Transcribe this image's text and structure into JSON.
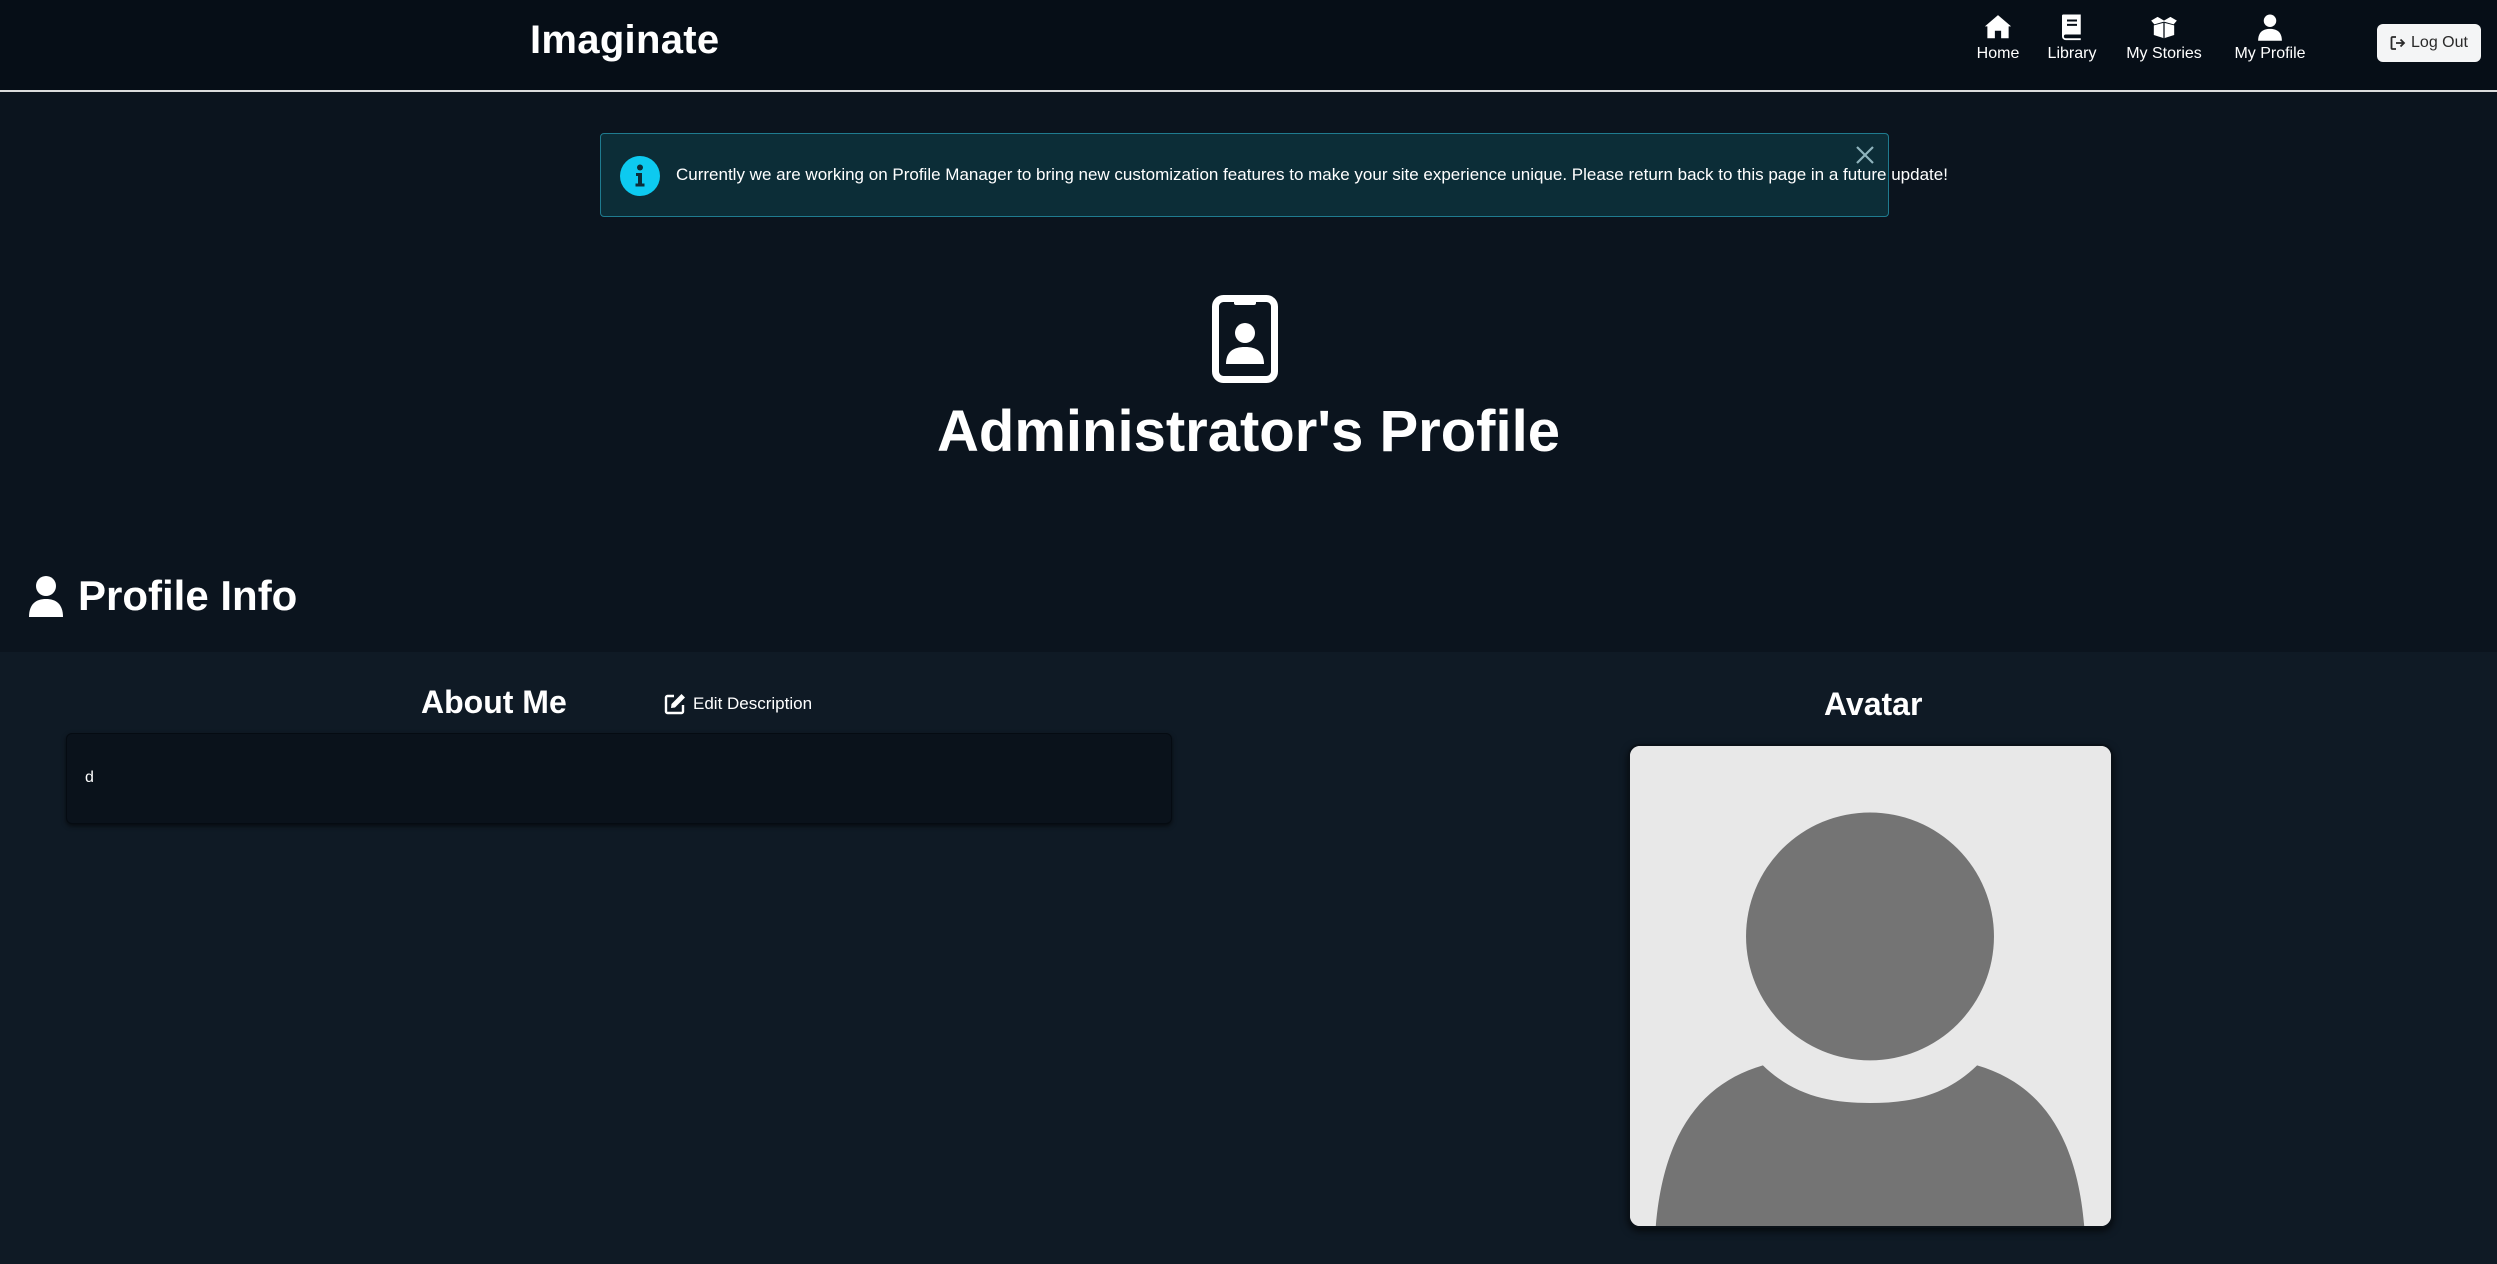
{
  "navbar": {
    "brand": "Imaginate",
    "items": [
      {
        "label": "Home",
        "icon": "home-icon"
      },
      {
        "label": "Library",
        "icon": "book-icon"
      },
      {
        "label": "My Stories",
        "icon": "box-open-icon"
      },
      {
        "label": "My Profile",
        "icon": "user-icon"
      }
    ],
    "logout_label": "Log Out",
    "logout_icon": "sign-out-icon"
  },
  "alert": {
    "icon": "info-circle-icon",
    "message": "Currently we are working on Profile Manager to bring new customization features to make your site experience unique. Please return back to this page in a future update!",
    "close_icon": "close-icon",
    "accent_color": "#0dcaf0"
  },
  "profile": {
    "badge_icon": "id-badge-icon",
    "title": "Administrator's Profile"
  },
  "profile_info": {
    "heading": "Profile Info",
    "heading_icon": "user-icon",
    "about": {
      "title": "About Me",
      "edit_label": "Edit Description",
      "edit_icon": "edit-icon",
      "text": "d"
    },
    "avatar": {
      "title": "Avatar",
      "image": "default-avatar-placeholder"
    }
  },
  "colors": {
    "page_bg": "#0b141e",
    "navbar_bg": "#060e17",
    "panel_bg": "#0f1a25",
    "alert_bg": "#0c2d37",
    "alert_border": "#1f7b8f"
  }
}
